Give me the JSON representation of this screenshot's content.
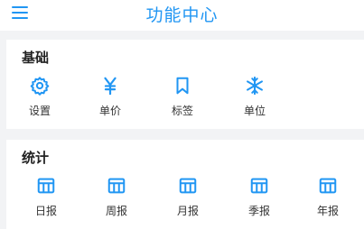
{
  "header": {
    "title": "功能中心",
    "menu_icon": "hamburger-menu-icon"
  },
  "sections": {
    "basic": {
      "title": "基础",
      "items": [
        {
          "label": "设置",
          "icon": "gear-icon"
        },
        {
          "label": "单价",
          "icon": "yen-icon"
        },
        {
          "label": "标签",
          "icon": "bookmark-icon"
        },
        {
          "label": "单位",
          "icon": "snowflake-icon"
        }
      ]
    },
    "stats": {
      "title": "统计",
      "items": [
        {
          "label": "日报",
          "icon": "calendar-report-icon"
        },
        {
          "label": "周报",
          "icon": "calendar-report-icon"
        },
        {
          "label": "月报",
          "icon": "calendar-report-icon"
        },
        {
          "label": "季报",
          "icon": "calendar-report-icon"
        },
        {
          "label": "年报",
          "icon": "calendar-report-icon"
        }
      ]
    }
  },
  "colors": {
    "accent": "#2196f3",
    "background": "#f2f3f5",
    "card": "#ffffff",
    "text": "#333333"
  }
}
